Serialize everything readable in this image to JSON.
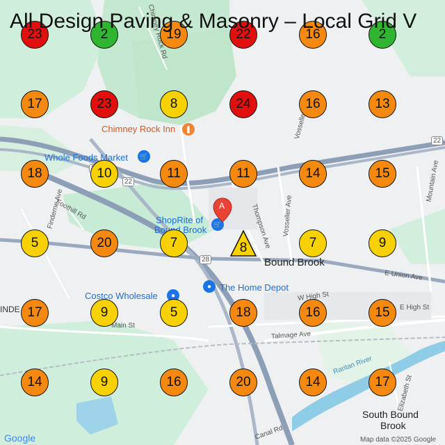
{
  "title": "All Design Paving & Masonry – Local Grid V",
  "colors": {
    "red": "#e20f0f",
    "green": "#2fb52f",
    "orange": "#f5890f",
    "yellow": "#f7d200"
  },
  "grid": [
    [
      {
        "v": "23",
        "c": "red"
      },
      {
        "v": "2",
        "c": "green"
      },
      {
        "v": "19",
        "c": "orange"
      },
      {
        "v": "22",
        "c": "red"
      },
      {
        "v": "16",
        "c": "orange"
      },
      {
        "v": "2",
        "c": "green"
      }
    ],
    [
      {
        "v": "17",
        "c": "orange"
      },
      {
        "v": "23",
        "c": "red"
      },
      {
        "v": "8",
        "c": "yellow"
      },
      {
        "v": "24",
        "c": "red"
      },
      {
        "v": "16",
        "c": "orange"
      },
      {
        "v": "13",
        "c": "orange"
      }
    ],
    [
      {
        "v": "18",
        "c": "orange"
      },
      {
        "v": "10",
        "c": "yellow"
      },
      {
        "v": "11",
        "c": "orange"
      },
      {
        "v": "11",
        "c": "orange"
      },
      {
        "v": "14",
        "c": "orange"
      },
      {
        "v": "15",
        "c": "orange"
      }
    ],
    [
      {
        "v": "5",
        "c": "yellow"
      },
      {
        "v": "20",
        "c": "orange"
      },
      {
        "v": "7",
        "c": "yellow"
      },
      {
        "v": "8",
        "c": "yellow",
        "center": true
      },
      {
        "v": "7",
        "c": "yellow"
      },
      {
        "v": "9",
        "c": "yellow"
      }
    ],
    [
      {
        "v": "17",
        "c": "orange"
      },
      {
        "v": "9",
        "c": "yellow"
      },
      {
        "v": "5",
        "c": "yellow"
      },
      {
        "v": "18",
        "c": "orange"
      },
      {
        "v": "16",
        "c": "orange"
      },
      {
        "v": "15",
        "c": "orange"
      }
    ],
    [
      {
        "v": "14",
        "c": "orange"
      },
      {
        "v": "9",
        "c": "yellow"
      },
      {
        "v": "16",
        "c": "orange"
      },
      {
        "v": "20",
        "c": "orange"
      },
      {
        "v": "14",
        "c": "orange"
      },
      {
        "v": "17",
        "c": "orange"
      }
    ]
  ],
  "places": {
    "chimney": "Chimney Rock Inn",
    "wholefoods": "Whole Foods Market",
    "shoprite1": "ShopRite of",
    "shoprite2": "Bound Brook",
    "boundbrook": "Bound Brook",
    "homedepot": "The Home Depot",
    "costco": "Costco Wholesale",
    "southbb1": "South Bound",
    "southbb2": "Brook",
    "marker": "A"
  },
  "streets": {
    "chimneyrd": "Chimney Rock Rd",
    "thompson": "Thompson Ave",
    "vosseller": "Vosseller Ave",
    "vosseller2": "Vosseller",
    "mountain": "Mountain Ave",
    "finderne": "Finderne Ave",
    "foothill": "Foothill Rd",
    "eunion": "E Union Ave",
    "whigh": "W High St",
    "ehigh": "E High St",
    "mainst": "Main St",
    "talmage": "Talmage Ave",
    "raritan": "Raritan River",
    "elizabeth": "Elizabeth St",
    "canal": "Canal Rd",
    "inde": "INDE",
    "r22a": "22",
    "r22b": "22",
    "r22c": "22",
    "r28": "28"
  },
  "footer": {
    "google": "Google",
    "copyright": "Map data ©2025 Google"
  }
}
